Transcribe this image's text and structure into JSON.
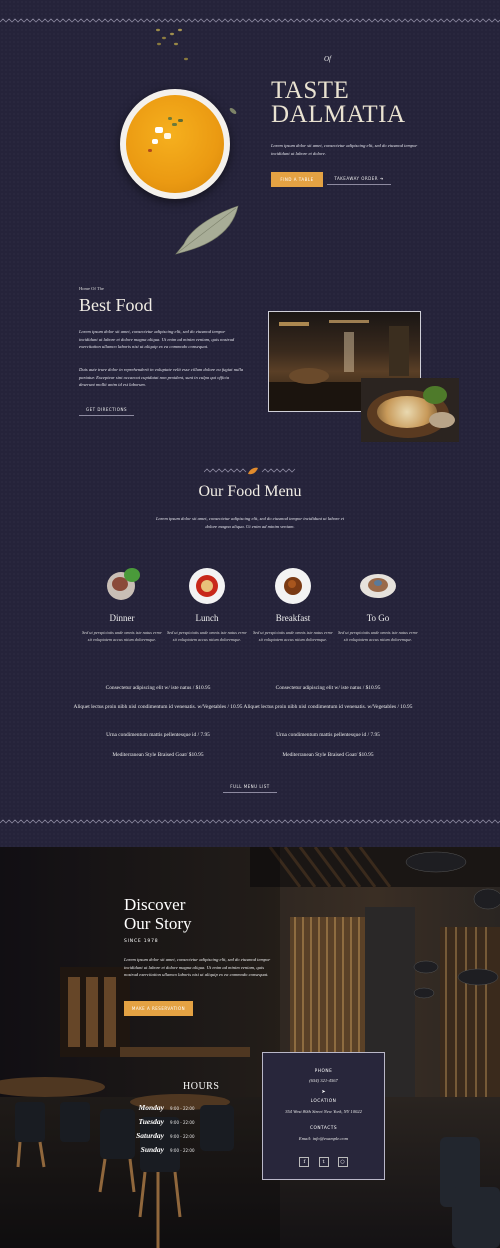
{
  "hero": {
    "of": "Of",
    "title_line1": "TASTE",
    "title_line2": "DALMATIA",
    "text": "Lorem ipsum dolor sit amet, consectetur adipiscing elit, sed do eiusmod tempor incididunt ut labore et dolore.",
    "find_table": "FIND A TABLE",
    "takeaway": "TAKEAWAY ORDER ➔"
  },
  "about": {
    "eyebrow": "Home Of The",
    "title": "Best Food",
    "para1": "Lorem ipsum dolor sit amet, consectetur adipiscing elit, sed do eiusmod tempor incididunt ut labore et dolore magna aliqua. Ut enim ad minim veniam, quis nostrud exercitation ullamco laboris nisi ut aliquip ex ea commodo consequat.",
    "para2": "Duis aute irure dolor in reprehenderit in voluptate velit esse cillum dolore eu fugiat nulla pariatur. Excepteur sint occaecat cupidatat non proident, sunt in culpa qui officia deserunt mollit anim id est laborum.",
    "directions": "GET DIRECTIONS"
  },
  "menu": {
    "title": "Our Food Menu",
    "intro": "Lorem ipsum dolor sit amet, consectetur adipiscing elit, sed do eiusmod tempor incididunt ut labore et dolore magna aliqua. Ut enim ad minim veniam.",
    "categories": [
      {
        "name": "Dinner",
        "desc": "Sed ut perspiciatis unde omnis iste natus error sit voluptatem accus ntium doloremque."
      },
      {
        "name": "Lunch",
        "desc": "Sed ut perspiciatis unde omnis iste natus error sit voluptatem accus ntium doloremque."
      },
      {
        "name": "Breakfast",
        "desc": "Sed ut perspiciatis unde omnis iste natus error sit voluptatem accus ntium doloremque."
      },
      {
        "name": "To Go",
        "desc": "Sed ut perspiciatis unde omnis iste natus error sit voluptatem accus ntium doloremque."
      }
    ],
    "items_left": [
      "Consectetur adipiscing elit w/ iste natus / $10.95",
      "Aliquet lectus proin nibh nisl condimentum id venenatis. w/Vegetables / 10.95",
      "Urna condimentum mattis pellentesque id / 7.95",
      "Mediterranean Style Braised Goat/ $10.95"
    ],
    "items_right": [
      "Consectetur adipiscing elit w/ iste natus / $10.95",
      "Aliquet lectus proin nibh nisl condimentum id venenatis. w/Vegetables / 10.95",
      "Urna condimentum mattis pellentesque id / 7.95",
      "Mediterranean Style Braised Goat/ $10.95"
    ],
    "full_list": "FULL MENU LIST"
  },
  "story": {
    "title_line1": "Discover",
    "title_line2": "Our Story",
    "since": "SINCE 1978",
    "text": "Lorem ipsum dolor sit amet, consectetur adipiscing elit, sed do eiusmod tempor incididunt ut labore et dolore magna aliqua. Ut enim ad minim veniam, quis nostrud exercitation ullamco laboris nisi ut aliquip ex ea commodo consequat.",
    "reserve": "MAKE A RESERVATION"
  },
  "hours": {
    "title": "HOURS",
    "rows": [
      {
        "day": "Monday",
        "time": "9:00 - 22:00"
      },
      {
        "day": "Tuesday",
        "time": "9:00 - 22:00"
      },
      {
        "day": "Saturday",
        "time": "9:00 - 22:00"
      },
      {
        "day": "Sunday",
        "time": "9:00 - 22:00"
      }
    ]
  },
  "contact": {
    "phone_label": "PHONE",
    "phone": "(654) 321-4567",
    "location_label": "LOCATION",
    "address": "354 West 80th Street New York, NY 10022",
    "contacts_label": "CONTACTS",
    "email": "Email: info@example.com",
    "social_icons": [
      "facebook-icon",
      "twitter-icon",
      "instagram-icon"
    ]
  },
  "colors": {
    "bg": "#25233a",
    "accent": "#e4a243"
  }
}
